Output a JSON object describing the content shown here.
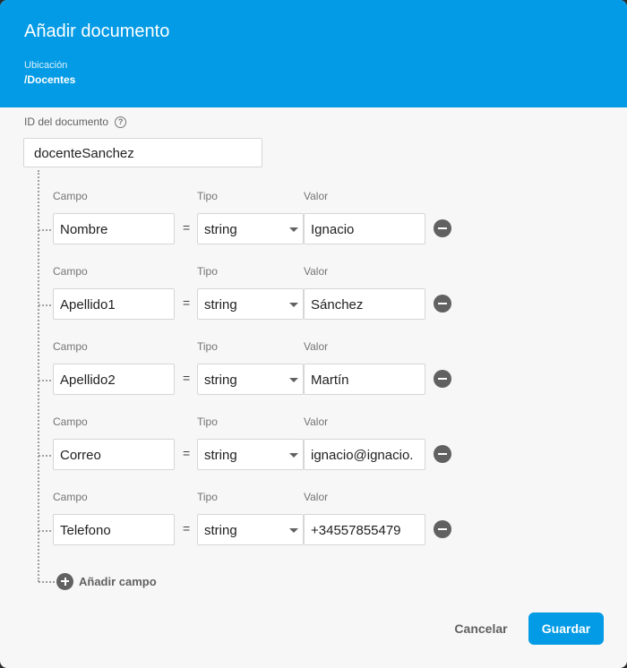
{
  "dialog": {
    "title": "Añadir documento",
    "location_label": "Ubicación",
    "location_path": "/Docentes"
  },
  "doc_id": {
    "label": "ID del documento",
    "help_icon": "help-circle-icon",
    "value": "docenteSanchez"
  },
  "labels": {
    "field": "Campo",
    "type": "Tipo",
    "value": "Valor",
    "equals": "="
  },
  "fields": [
    {
      "name": "Nombre",
      "type": "string",
      "value": "Ignacio"
    },
    {
      "name": "Apellido1",
      "type": "string",
      "value": "Sánchez"
    },
    {
      "name": "Apellido2",
      "type": "string",
      "value": "Martín"
    },
    {
      "name": "Correo",
      "type": "string",
      "value": "ignacio@ignacio."
    },
    {
      "name": "Telefono",
      "type": "string",
      "value": "+34557855479"
    }
  ],
  "add_field_label": "Añadir campo",
  "buttons": {
    "cancel": "Cancelar",
    "save": "Guardar"
  },
  "colors": {
    "primary": "#039be5",
    "icon_gray": "#616161"
  }
}
